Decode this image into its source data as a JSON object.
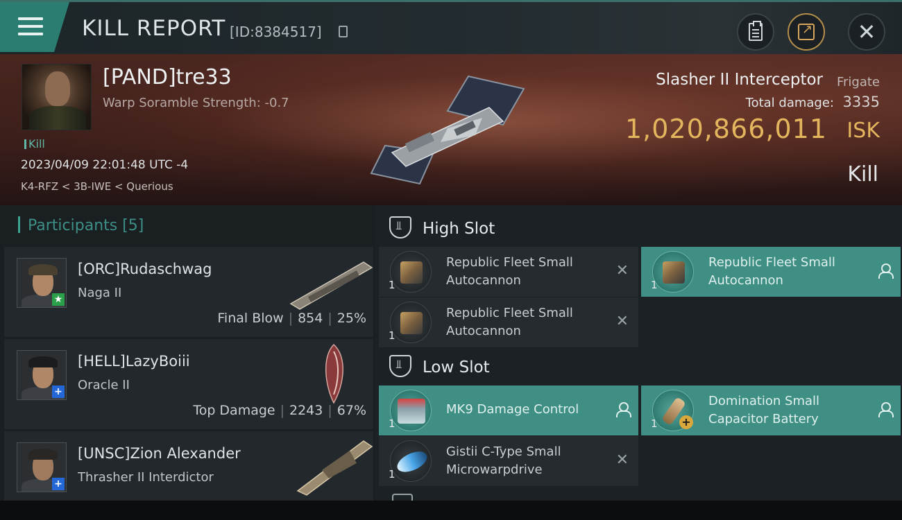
{
  "header": {
    "title": "KILL REPORT",
    "report_id": "[ID:8384517]"
  },
  "victim": {
    "name": "[PAND]tre33",
    "scramble": "Warp Soramble Strength: -0.7",
    "tag": "Kill",
    "timestamp": "2023/04/09 22:01:48 UTC -4",
    "location": "K4-RFZ < 3B-IWE < Querious",
    "ship_name": "Slasher II Interceptor",
    "ship_class": "Frigate",
    "damage_label": "Total damage:",
    "damage_value": "3335",
    "isk_value": "1,020,866,011",
    "isk_unit": "ISK",
    "result": "Kill"
  },
  "participants": {
    "label": "Participants [5]",
    "items": [
      {
        "name": "[ORC]Rudaschwag",
        "ship": "Naga II",
        "role": "Final Blow",
        "damage": "854",
        "percent": "25%"
      },
      {
        "name": "[HELL]LazyBoiii",
        "ship": "Oracle II",
        "role": "Top Damage",
        "damage": "2243",
        "percent": "67%"
      },
      {
        "name": "[UNSC]Zion Alexander",
        "ship": "Thrasher II Interdictor",
        "role": "",
        "damage": "",
        "percent": ""
      }
    ]
  },
  "slots": {
    "high": {
      "label": "High Slot",
      "modules": [
        {
          "name": "Republic Fleet Small Autocannon",
          "qty": "1",
          "status": "destroyed"
        },
        {
          "name": "Republic Fleet Small Autocannon",
          "qty": "1",
          "status": "dropped"
        },
        {
          "name": "Republic Fleet Small Autocannon",
          "qty": "1",
          "status": "destroyed"
        }
      ]
    },
    "low": {
      "label": "Low Slot",
      "modules": [
        {
          "name": "MK9 Damage Control",
          "qty": "1",
          "status": "dropped"
        },
        {
          "name": "Domination Small Capacitor Battery",
          "qty": "1",
          "status": "dropped"
        },
        {
          "name": "Gistii C-Type Small Microwarpdrive",
          "qty": "1",
          "status": "destroyed"
        }
      ]
    }
  },
  "status_glyphs": {
    "destroyed": "✕"
  },
  "colors": {
    "accent": "#3f8f85",
    "isk": "#e3b65e",
    "participants": "#3d8f86"
  },
  "icons": [
    "menu-icon",
    "copy-icon",
    "clipboard-icon",
    "share-icon",
    "close-icon",
    "slot-icon",
    "person-icon"
  ]
}
